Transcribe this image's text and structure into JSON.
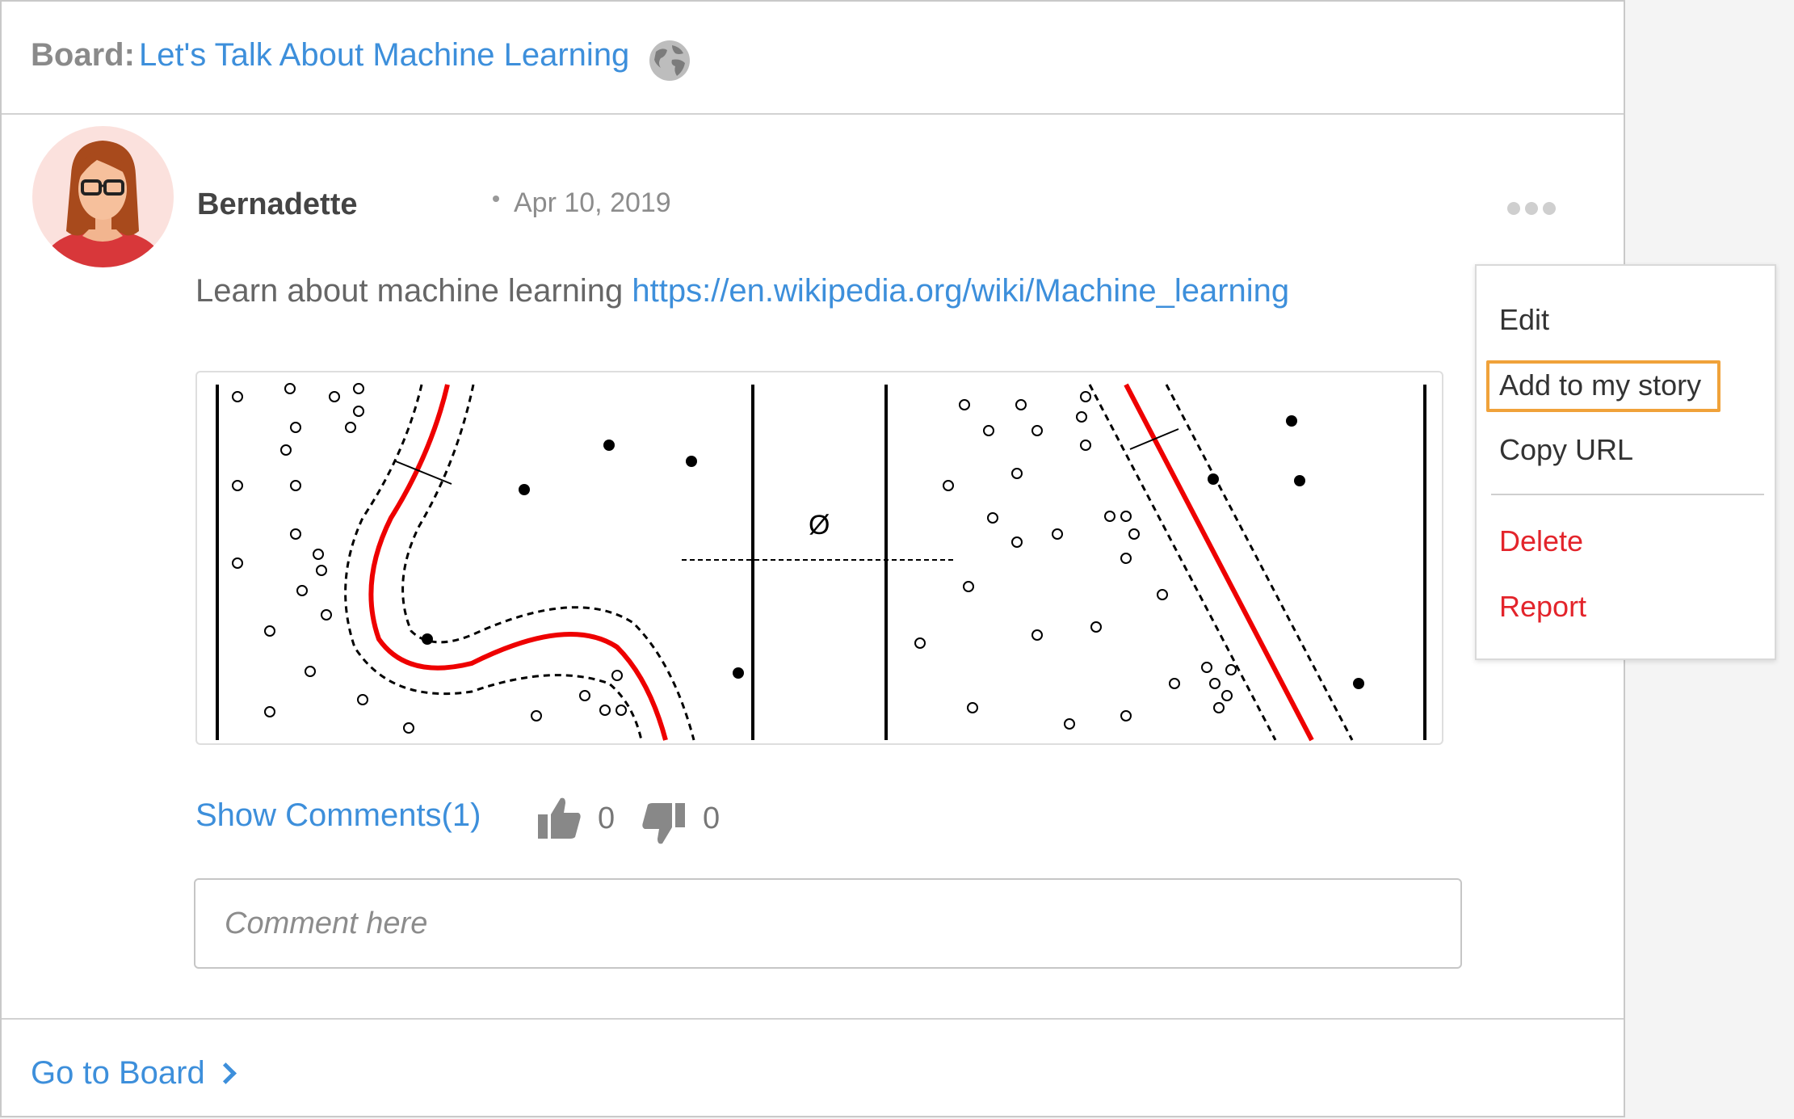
{
  "board": {
    "label": "Board:",
    "name": "Let's Talk About Machine Learning",
    "icon": "globe-icon"
  },
  "post": {
    "author": "Bernadette",
    "date": "Apr 10, 2019",
    "text": "Learn about machine learning ",
    "link": "https://en.wikipedia.org/wiki/Machine_learning",
    "figure_label": "Ø"
  },
  "actions": {
    "show_comments": "Show Comments(1)",
    "likes": "0",
    "dislikes": "0"
  },
  "comment": {
    "placeholder": "Comment here"
  },
  "footer": {
    "go_to_board": "Go to Board"
  },
  "menu": {
    "items": [
      {
        "label": "Edit",
        "danger": false
      },
      {
        "label": "Add to my story",
        "danger": false,
        "highlighted": true
      },
      {
        "label": "Copy URL",
        "danger": false
      },
      {
        "label": "Delete",
        "danger": true
      },
      {
        "label": "Report",
        "danger": true
      }
    ]
  },
  "colors": {
    "link": "#3d8fdb",
    "danger": "#e3242b",
    "highlight": "#f0a23a",
    "muted": "#8a8a8a"
  }
}
